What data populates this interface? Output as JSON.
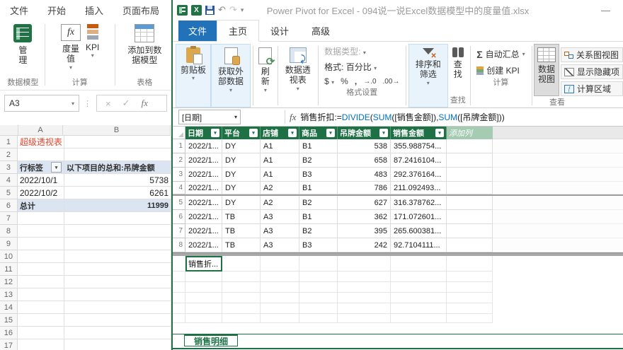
{
  "icons": {
    "dropdown": "▾",
    "filter_arrow": "▾",
    "undo": "↶",
    "redo": "↷",
    "qat_more": "▾",
    "cancel": "×",
    "check": "✓",
    "fx": "fx",
    "dots": "⋮",
    "minimize": "—",
    "sigma": "Σ"
  },
  "excel": {
    "tabs": [
      "文件",
      "开始",
      "插入",
      "页面布局"
    ],
    "ribbon": {
      "manage": "管理",
      "measures": "度量值",
      "kpi": "KPI",
      "add_to_model": "添加到数据模型",
      "group_model": "数据模型",
      "group_calc": "计算",
      "group_table": "表格"
    },
    "name_box": "A3",
    "col_a": "A",
    "col_b": "B",
    "row_count": 17,
    "cells": {
      "a1": "超级透视表",
      "a3": "行标签",
      "b3": "以下项目的总和:吊牌金额",
      "a4": "2022/10/1",
      "b4": "5738",
      "a5": "2022/10/2",
      "b5": "6261",
      "a6": "总计",
      "b6": "11999"
    }
  },
  "powerpivot": {
    "title": "Power Pivot for Excel - 094说一说Excel数据模型中的度量值.xlsx",
    "tabs": [
      "文件",
      "主页",
      "设计",
      "高级"
    ],
    "ribbon": {
      "clipboard": "剪贴板",
      "get_external": "获取外部数据",
      "refresh": "刷新",
      "pivot_table": "数据透视表",
      "data_type": "数据类型:",
      "format": "格式: 百分比",
      "currency": "$",
      "percent": "%",
      "thousands": ",",
      "inc_decimal": "→.0",
      "dec_decimal": ".00→",
      "group_format": "格式设置",
      "sort_filter": "排序和筛选",
      "find": "查找",
      "group_find": "查找",
      "autosum": "自动汇总",
      "create_kpi": "创建 KPI",
      "group_calc": "计算",
      "data_view": "数据视图",
      "diagram_view": "关系图视图",
      "show_hidden": "显示隐藏项",
      "calc_area": "计算区域",
      "group_view": "查看"
    },
    "formula_bar": {
      "cell_ref": "[日期]",
      "formula": "销售折扣:=DIVIDE(SUM([销售金额]),SUM([吊牌金额]))",
      "segments": [
        "销售折扣:=",
        "DIVIDE",
        "(",
        "SUM",
        "([销售金额]),",
        "SUM",
        "([吊牌金额]))"
      ]
    },
    "grid": {
      "columns": [
        "日期",
        "平台",
        "店铺",
        "商品",
        "吊牌金额",
        "销售金额"
      ],
      "add_column": "添加列",
      "rows": [
        [
          "2022/1...",
          "DY",
          "A1",
          "B1",
          "538",
          "355.988754..."
        ],
        [
          "2022/1...",
          "DY",
          "A1",
          "B2",
          "658",
          "87.2416104..."
        ],
        [
          "2022/1...",
          "DY",
          "A1",
          "B3",
          "483",
          "292.376164..."
        ],
        [
          "2022/1...",
          "DY",
          "A2",
          "B1",
          "786",
          "211.092493..."
        ],
        [
          "2022/1...",
          "DY",
          "A2",
          "B2",
          "627",
          "316.378762..."
        ],
        [
          "2022/1...",
          "TB",
          "A3",
          "B1",
          "362",
          "171.072601..."
        ],
        [
          "2022/1...",
          "TB",
          "A3",
          "B2",
          "395",
          "265.600381..."
        ],
        [
          "2022/1...",
          "TB",
          "A3",
          "B3",
          "242",
          "92.7104111..."
        ]
      ]
    },
    "calc": {
      "measure": "销售折..."
    },
    "sheet_tab": "销售明细"
  }
}
